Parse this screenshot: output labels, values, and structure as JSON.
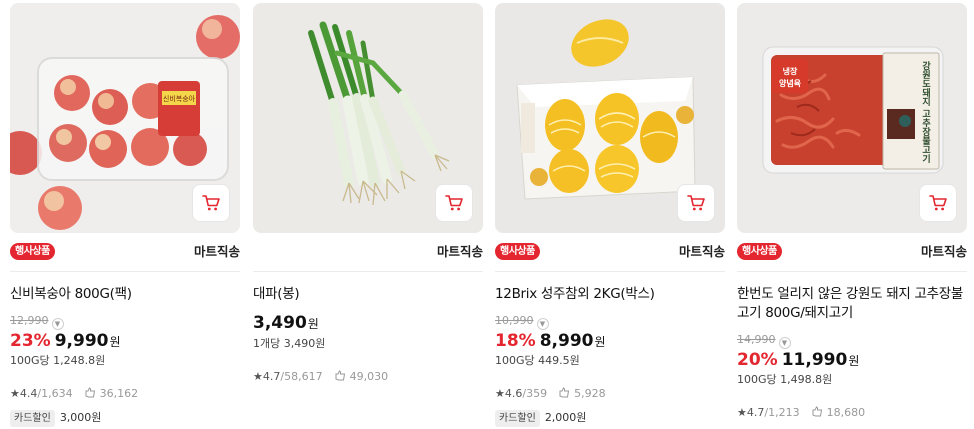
{
  "products": [
    {
      "image_alt": "peaches in plastic pack",
      "event_badge": "행사상품",
      "delivery": "마트직송",
      "name": "신비복숭아 800G(팩)",
      "original_price": "12,990",
      "discount": "23%",
      "price": "9,990",
      "won": "원",
      "unit_price": "100G당 1,248.8원",
      "rating": "4.4",
      "review_count": "/1,634",
      "purchase_count": "36,162",
      "payment_badge": "카드할인",
      "payment_amount": "3,000원"
    },
    {
      "image_alt": "green onion bunch",
      "event_badge": "",
      "delivery": "마트직송",
      "name": "대파(봉)",
      "original_price": "",
      "discount": "",
      "price": "3,490",
      "won": "원",
      "unit_price": "1개당 3,490원",
      "rating": "4.7",
      "review_count": "/58,617",
      "purchase_count": "49,030",
      "payment_badge": "",
      "payment_amount": ""
    },
    {
      "image_alt": "korean melons in box",
      "event_badge": "행사상품",
      "delivery": "마트직송",
      "name": "12Brix 성주참외 2KG(박스)",
      "original_price": "10,990",
      "discount": "18%",
      "price": "8,990",
      "won": "원",
      "unit_price": "100G당 449.5원",
      "rating": "4.6",
      "review_count": "/359",
      "purchase_count": "5,928",
      "payment_badge": "카드할인",
      "payment_amount": "2,000원"
    },
    {
      "image_alt": "marinated spicy pork package",
      "event_badge": "행사상품",
      "delivery": "마트직송",
      "name": "한번도 얼리지 않은 강원도 돼지 고추장불고기 800G/돼지고기",
      "original_price": "14,990",
      "discount": "20%",
      "price": "11,990",
      "won": "원",
      "unit_price": "100G당 1,498.8원",
      "rating": "4.7",
      "review_count": "/1,213",
      "purchase_count": "18,680",
      "payment_badge": "",
      "payment_amount": ""
    }
  ],
  "package_text": {
    "peach_label": "신비복숭아",
    "pork_label_1": "냉장",
    "pork_label_2": "양념육",
    "pork_title": "강원도돼지 고추장불고기"
  },
  "colors": {
    "accent_red": "#e3262f",
    "text_dark": "#111111",
    "muted": "#9a9a9a"
  },
  "icons": {
    "cart": "cart-icon",
    "star": "star-icon",
    "purchase": "purchase-count-icon",
    "chevron": "chevron-down-icon"
  }
}
